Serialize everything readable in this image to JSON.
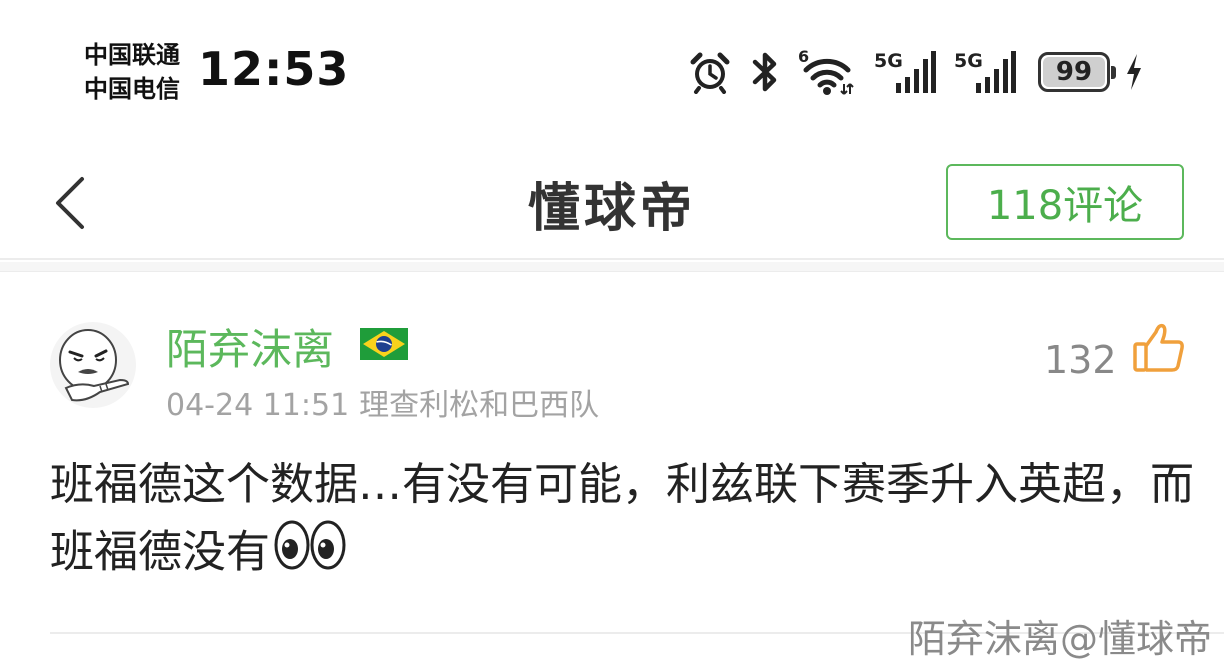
{
  "status_bar": {
    "carrier_1": "中国联通",
    "carrier_2": "中国电信",
    "time": "12:53",
    "wifi_badge": "6",
    "signal_1_label": "5G",
    "signal_2_label": "5G",
    "battery_level": "99",
    "icons": [
      "alarm-icon",
      "bluetooth-icon",
      "wifi-icon",
      "signal-icon",
      "signal-icon",
      "battery-icon",
      "charging-icon"
    ]
  },
  "nav": {
    "title": "懂球帝",
    "comment_count": "118评论",
    "accent_color": "#5cb85c"
  },
  "comment": {
    "username": "陌弃沫离",
    "flag": "brazil-flag-icon",
    "date": "04-24 11:51",
    "team": "理查利松和巴西队",
    "likes": "132",
    "body": "班福德这个数据…有没有可能，利兹联下赛季升入英超，而班福德没有"
  },
  "watermark": "陌弃沫离@懂球帝"
}
